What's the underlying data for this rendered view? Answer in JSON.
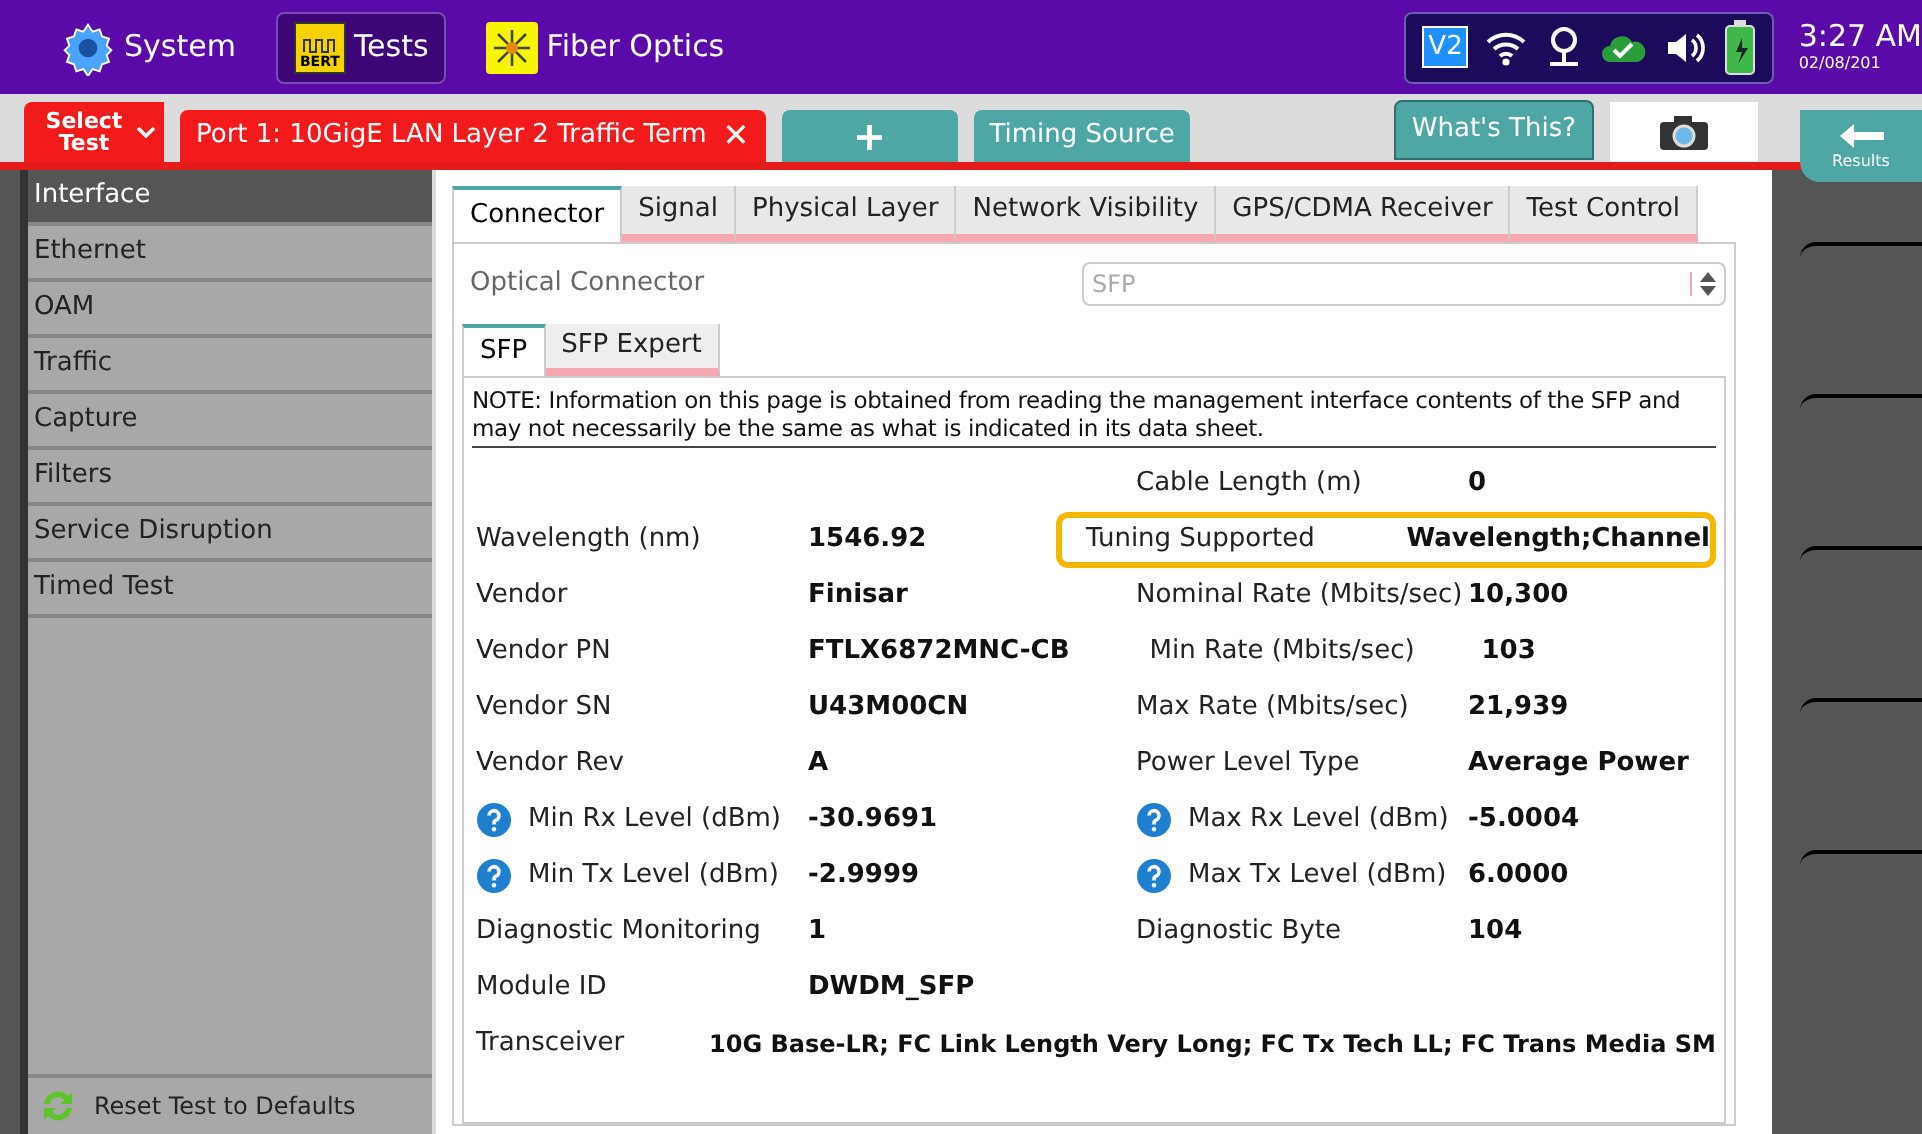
{
  "top_bar": {
    "apps": [
      {
        "label": "System",
        "kind": "system",
        "selected": false
      },
      {
        "label": "Tests",
        "kind": "tests",
        "icon_text": "BERT",
        "selected": true
      },
      {
        "label": "Fiber Optics",
        "kind": "fiber",
        "selected": false
      }
    ],
    "status_badge": "V2",
    "time": "3:27 AM",
    "date": "02/08/201"
  },
  "test_bar": {
    "select_label": "Select Test",
    "tabs": [
      {
        "label": "Port 1: 10GigE LAN Layer 2 Traffic Term",
        "kind": "test",
        "selected": true,
        "close": "✕"
      },
      {
        "label": "+",
        "kind": "add",
        "selected": false
      },
      {
        "label": "Timing Source",
        "kind": "test",
        "selected": false
      }
    ],
    "help_button": "What's This?"
  },
  "sidebar": {
    "items": [
      {
        "label": "Interface",
        "selected": true
      },
      {
        "label": "Ethernet",
        "selected": false
      },
      {
        "label": "OAM",
        "selected": false
      },
      {
        "label": "Traffic",
        "selected": false
      },
      {
        "label": "Capture",
        "selected": false
      },
      {
        "label": "Filters",
        "selected": false
      },
      {
        "label": "Service Disruption",
        "selected": false
      },
      {
        "label": "Timed Test",
        "selected": false
      }
    ],
    "reset_button": "Reset Test to Defaults"
  },
  "tabs": [
    {
      "label": "Connector",
      "selected": true
    },
    {
      "label": "Signal",
      "selected": false
    },
    {
      "label": "Physical Layer",
      "selected": false
    },
    {
      "label": "Network Visibility",
      "selected": false
    },
    {
      "label": "GPS/CDMA Receiver",
      "selected": false
    },
    {
      "label": "Test Control",
      "selected": false
    }
  ],
  "optical_connector": {
    "label": "Optical Connector",
    "value": "SFP",
    "disabled": true
  },
  "sub_tabs": [
    {
      "label": "SFP",
      "selected": true
    },
    {
      "label": "SFP Expert",
      "selected": false
    }
  ],
  "note": "NOTE: Information on this page is obtained from reading the management interface contents of the SFP and may not necessarily be the same as what is indicated in its data sheet.",
  "rows": [
    {
      "right": {
        "label": "Cable Length (m)",
        "value": "0"
      }
    },
    {
      "left": {
        "label": "Wavelength (nm)",
        "value": "1546.92"
      },
      "right": {
        "label": "Tuning Supported",
        "value": "Wavelength;Channel",
        "highlighted": true
      }
    },
    {
      "left": {
        "label": "Vendor",
        "value": "Finisar"
      },
      "right": {
        "label": "Nominal Rate (Mbits/sec)",
        "value": "10,300"
      }
    },
    {
      "left": {
        "label": "Vendor PN",
        "value": "FTLX6872MNC-CB"
      },
      "right": {
        "label": "Min Rate (Mbits/sec)",
        "value": "103"
      }
    },
    {
      "left": {
        "label": "Vendor SN",
        "value": "U43M00CN"
      },
      "right": {
        "label": "Max Rate (Mbits/sec)",
        "value": "21,939"
      }
    },
    {
      "left": {
        "label": "Vendor Rev",
        "value": "A"
      },
      "right": {
        "label": "Power Level Type",
        "value": "Average Power"
      }
    },
    {
      "left": {
        "label": "Min Rx Level (dBm)",
        "value": "-30.9691",
        "help": true
      },
      "right": {
        "label": "Max Rx Level (dBm)",
        "value": "-5.0004",
        "help": true
      }
    },
    {
      "left": {
        "label": "Min Tx Level (dBm)",
        "value": "-2.9999",
        "help": true
      },
      "right": {
        "label": "Max Tx Level (dBm)",
        "value": "6.0000",
        "help": true
      }
    },
    {
      "left": {
        "label": "Diagnostic Monitoring",
        "value": "1"
      },
      "right": {
        "label": "Diagnostic Byte",
        "value": "104"
      }
    },
    {
      "left": {
        "label": "Module ID",
        "value": "DWDM_SFP"
      }
    }
  ],
  "transceiver": {
    "label": "Transceiver",
    "value": "10G Base-LR; FC Link Length Very Long; FC Tx Tech LL; FC Trans Media SM"
  },
  "right_panel": {
    "results_button": "Results"
  }
}
